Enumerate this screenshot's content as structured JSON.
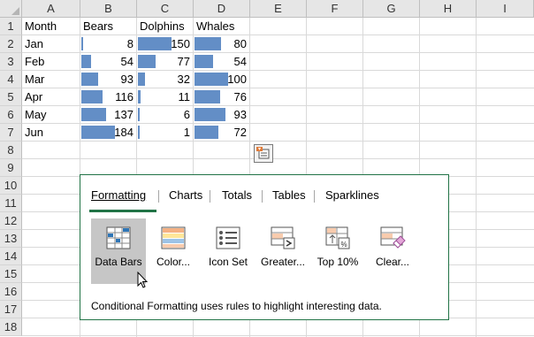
{
  "columns": [
    "A",
    "B",
    "C",
    "D",
    "E",
    "F",
    "G",
    "H",
    "I"
  ],
  "rows": [
    "1",
    "2",
    "3",
    "4",
    "5",
    "6",
    "7",
    "8",
    "9",
    "10",
    "11",
    "12",
    "13",
    "14",
    "15",
    "16",
    "17",
    "18"
  ],
  "table": {
    "headers": [
      "Month",
      "Bears",
      "Dolphins",
      "Whales"
    ],
    "rows": [
      {
        "month": "Jan",
        "bears": "8",
        "dolphins": "150",
        "whales": "80"
      },
      {
        "month": "Feb",
        "bears": "54",
        "dolphins": "77",
        "whales": "54"
      },
      {
        "month": "Mar",
        "bears": "93",
        "dolphins": "32",
        "whales": "100"
      },
      {
        "month": "Apr",
        "bears": "116",
        "dolphins": "11",
        "whales": "76"
      },
      {
        "month": "May",
        "bears": "137",
        "dolphins": "6",
        "whales": "93"
      },
      {
        "month": "Jun",
        "bears": "184",
        "dolphins": "1",
        "whales": "72"
      }
    ]
  },
  "quick_analysis": {
    "button_icon": "quick-analysis-icon",
    "tabs": [
      "Formatting",
      "Charts",
      "Totals",
      "Tables",
      "Sparklines"
    ],
    "active_tab": "Formatting",
    "options": [
      {
        "label": "Data Bars",
        "icon": "data-bars-icon",
        "selected": true
      },
      {
        "label": "Color...",
        "icon": "color-scale-icon",
        "selected": false
      },
      {
        "label": "Icon Set",
        "icon": "icon-set-icon",
        "selected": false
      },
      {
        "label": "Greater...",
        "icon": "greater-than-icon",
        "selected": false
      },
      {
        "label": "Top 10%",
        "icon": "top-ten-icon",
        "selected": false
      },
      {
        "label": "Clear...",
        "icon": "clear-format-icon",
        "selected": false
      }
    ],
    "description": "Conditional Formatting uses rules to highlight interesting data."
  },
  "colors": {
    "accent": "#217346",
    "data_bar": "#638ec6",
    "header_bg": "#e6e6e6"
  }
}
